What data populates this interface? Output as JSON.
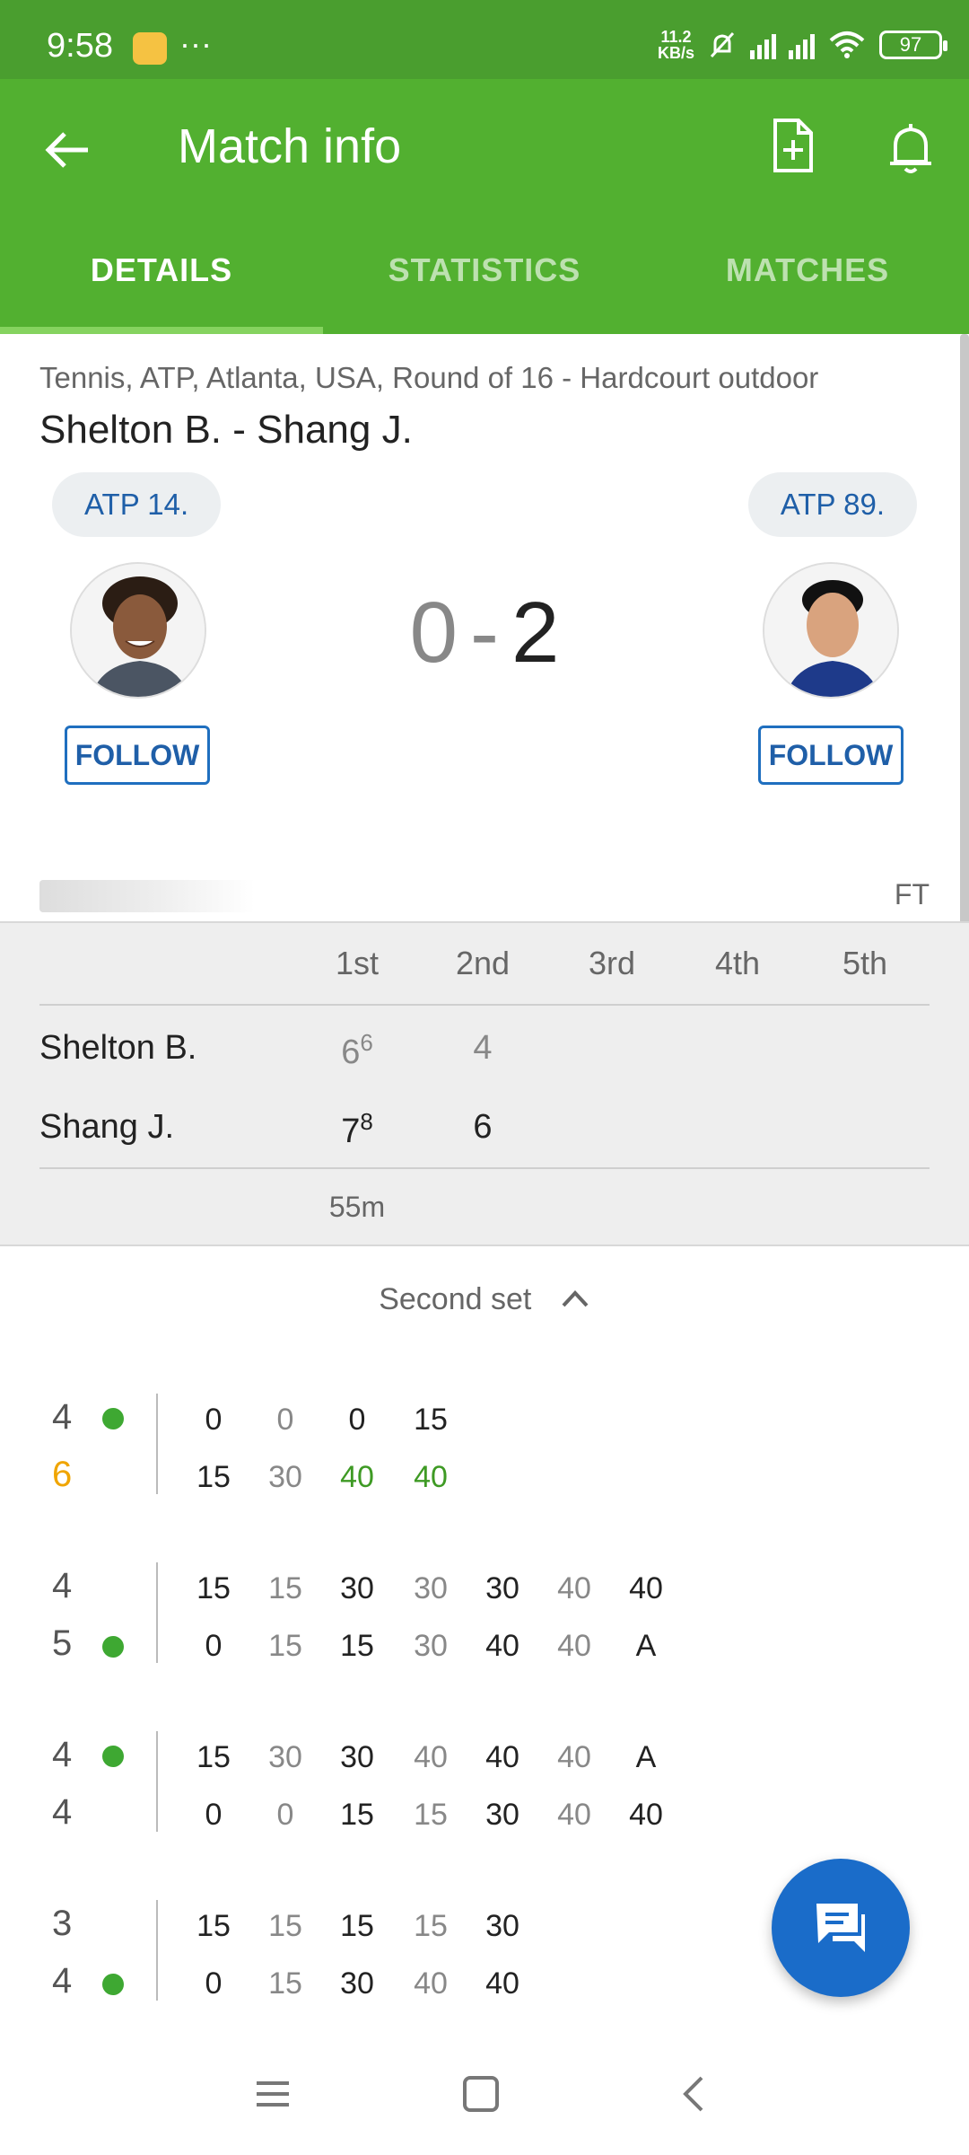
{
  "status_bar": {
    "time": "9:58",
    "dots": "···",
    "speed_line1": "11.2",
    "speed_line2": "KB/s",
    "battery": "97"
  },
  "app_bar": {
    "title": "Match info"
  },
  "tabs": [
    {
      "label": "DETAILS",
      "active": true
    },
    {
      "label": "STATISTICS",
      "active": false
    },
    {
      "label": "MATCHES",
      "active": false
    }
  ],
  "match": {
    "meta": "Tennis, ATP, Atlanta, USA, Round of 16 - Hardcourt outdoor",
    "name": "Shelton B. - Shang J.",
    "home_rank": "ATP 14.",
    "away_rank": "ATP 89.",
    "home_sets": "0",
    "separator": "-",
    "away_sets": "2",
    "follow_label": "FOLLOW",
    "status": "FT"
  },
  "sets_table": {
    "headers": [
      "1st",
      "2nd",
      "3rd",
      "4th",
      "5th"
    ],
    "rows": [
      {
        "player": "Shelton B.",
        "s1": "6",
        "s1_tb": "6",
        "s2": "4"
      },
      {
        "player": "Shang J.",
        "s1": "7",
        "s1_tb": "8",
        "s2": "6"
      }
    ],
    "duration": "55m"
  },
  "set_toggle": {
    "label": "Second set"
  },
  "games": [
    {
      "home_games": "4",
      "away_games": "6",
      "server": "home",
      "winner": "away",
      "home_points": [
        "0",
        "0",
        "0",
        "15"
      ],
      "away_points": [
        "15",
        "30",
        "40",
        "40"
      ]
    },
    {
      "home_games": "4",
      "away_games": "5",
      "server": "away",
      "winner": "",
      "home_points": [
        "15",
        "15",
        "30",
        "30",
        "30",
        "40",
        "40"
      ],
      "away_points": [
        "0",
        "15",
        "15",
        "30",
        "40",
        "40",
        "A"
      ]
    },
    {
      "home_games": "4",
      "away_games": "4",
      "server": "home",
      "winner": "",
      "home_points": [
        "15",
        "30",
        "30",
        "40",
        "40",
        "40",
        "A"
      ],
      "away_points": [
        "0",
        "0",
        "15",
        "15",
        "30",
        "40",
        "40"
      ]
    },
    {
      "home_games": "3",
      "away_games": "4",
      "server": "away",
      "winner": "",
      "home_points": [
        "15",
        "15",
        "15",
        "15",
        "30"
      ],
      "away_points": [
        "0",
        "15",
        "30",
        "40",
        "40"
      ]
    }
  ],
  "colors": {
    "appbar": "#52b030",
    "statusbar": "#4a9e2f",
    "accent_blue": "#1a6cc9",
    "serve_dot": "#3ea832",
    "game_winner": "#f0a500"
  },
  "icons": {
    "back": "arrow-left-icon",
    "doc": "document-add-icon",
    "bell": "bell-icon",
    "fab": "chat-icon",
    "chevron": "chevron-up-icon"
  }
}
